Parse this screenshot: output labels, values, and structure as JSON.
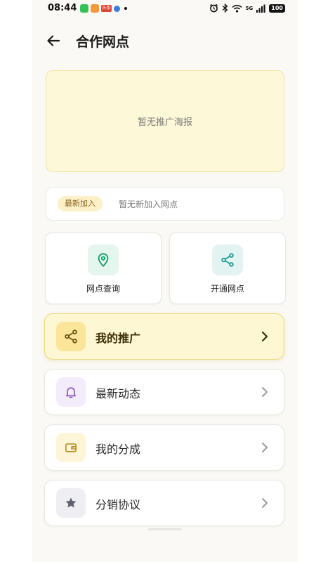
{
  "status_bar": {
    "time": "08:44",
    "app_badge": "头条",
    "signal_label": "5G",
    "battery": "100"
  },
  "header": {
    "title": "合作网点",
    "back_icon": "arrow-left-icon"
  },
  "poster": {
    "empty_text": "暂无推广海报"
  },
  "joined": {
    "badge": "最新加入",
    "text": "暂无新加入网点"
  },
  "tiles": [
    {
      "label": "网点查询",
      "icon": "location-pin-icon",
      "color": "#1a9a6e"
    },
    {
      "label": "开通网点",
      "icon": "share-icon",
      "color": "#1a9a8a"
    }
  ],
  "menu": [
    {
      "label": "我的推广",
      "icon": "share-icon",
      "featured": true,
      "icon_bg": "#fbe59a",
      "icon_color": "#7a5d12"
    },
    {
      "label": "最新动态",
      "icon": "bell-icon",
      "featured": false,
      "icon_bg": "#f3ecfb",
      "icon_color": "#8a4cc2"
    },
    {
      "label": "我的分成",
      "icon": "wallet-icon",
      "featured": false,
      "icon_bg": "#fdf5d8",
      "icon_color": "#b58a1e"
    },
    {
      "label": "分销协议",
      "icon": "star-icon",
      "featured": false,
      "icon_bg": "#efeff3",
      "icon_color": "#5f6170"
    }
  ],
  "colors": {
    "background": "#faf9f5",
    "accent_yellow": "#fdf7d4"
  }
}
